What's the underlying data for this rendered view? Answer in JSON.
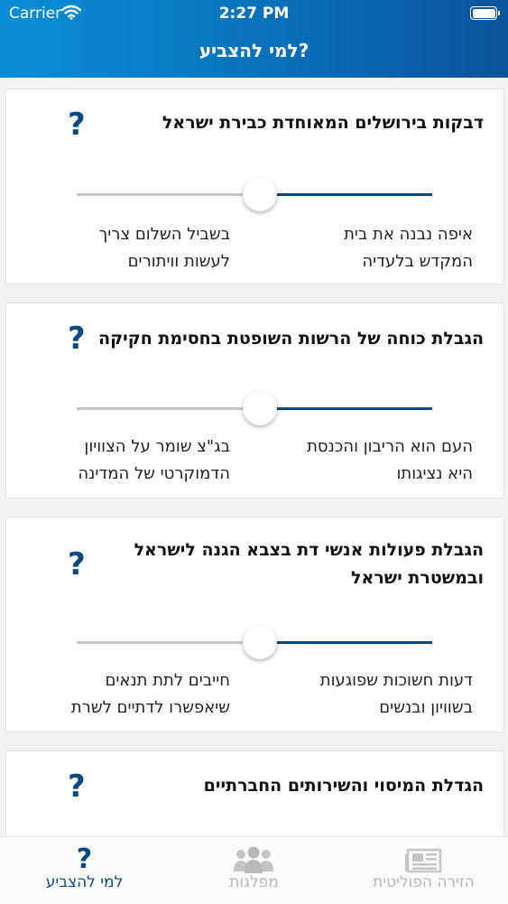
{
  "status_bar": {
    "carrier": "Carrier",
    "time": "2:27 PM"
  },
  "nav": {
    "title": "למי להצביע?"
  },
  "questions": [
    {
      "title_lines": [
        "דבקות בירושלים המאוחדת כבירת ישראל"
      ],
      "help": "?",
      "right_label_lines": [
        "איפה נבנה את בית",
        "המקדש בלעדיה"
      ],
      "left_label_lines": [
        "בשביל השלום צריך",
        "לעשות וויתורים"
      ],
      "slider_value": 0.5
    },
    {
      "title_lines": [
        "הגבלת כוחה של הרשות השופטת בחסימת חקיקה"
      ],
      "help": "?",
      "right_label_lines": [
        "העם הוא הריבון והכנסת",
        "היא נציגותו"
      ],
      "left_label_lines": [
        "בג\"צ שומר על הצוויון",
        "הדמוקרטי של המדינה"
      ],
      "slider_value": 0.5
    },
    {
      "title_lines": [
        "הגבלת פעולות אנשי דת בצבא הגנה לישראל",
        "ובמשטרת ישראל"
      ],
      "help": "?",
      "right_label_lines": [
        "דעות חשוכות שפוגעות",
        "בשוויון ובנשים"
      ],
      "left_label_lines": [
        "חייבים לתת תנאים",
        "שיאפשרו לדתיים לשרת"
      ],
      "slider_value": 0.5
    },
    {
      "title_lines": [
        "הגדלת המיסוי והשירותים החברתיים"
      ],
      "help": "?"
    }
  ],
  "tabs": [
    {
      "label": "למי להצביע",
      "icon": "question-icon",
      "active": true
    },
    {
      "label": "מפלגות",
      "icon": "people-icon",
      "active": false
    },
    {
      "label": "הזירה הפוליטית",
      "icon": "newspaper-icon",
      "active": false
    }
  ],
  "colors": {
    "header_start": "#0a8fd6",
    "header_end": "#0b559c",
    "accent": "#0a4a80",
    "inactive": "#b8b8b8"
  }
}
